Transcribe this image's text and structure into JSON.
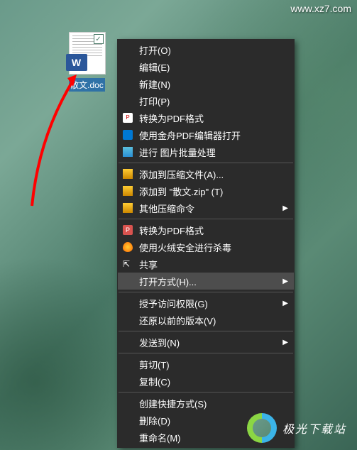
{
  "watermark": "www.xz7.com",
  "file": {
    "label": "散文.doc",
    "badge": "W"
  },
  "menu": {
    "open": "打开(O)",
    "edit": "编辑(E)",
    "new": "新建(N)",
    "print": "打印(P)",
    "to_pdf": "转换为PDF格式",
    "jinshan_pdf": "使用金舟PDF编辑器打开",
    "batch_image": "进行 图片批量处理",
    "add_archive": "添加到压缩文件(A)...",
    "add_zip": "添加到 \"散文.zip\" (T)",
    "other_zip": "其他压缩命令",
    "to_pdf2": "转换为PDF格式",
    "huorong": "使用火绒安全进行杀毒",
    "share": "共享",
    "open_with": "打开方式(H)...",
    "grant_access": "授予访问权限(G)",
    "restore_prev": "还原以前的版本(V)",
    "send_to": "发送到(N)",
    "cut": "剪切(T)",
    "copy": "复制(C)",
    "create_shortcut": "创建快捷方式(S)",
    "delete": "删除(D)",
    "rename": "重命名(M)"
  },
  "logo": {
    "text": "极光下载站"
  }
}
